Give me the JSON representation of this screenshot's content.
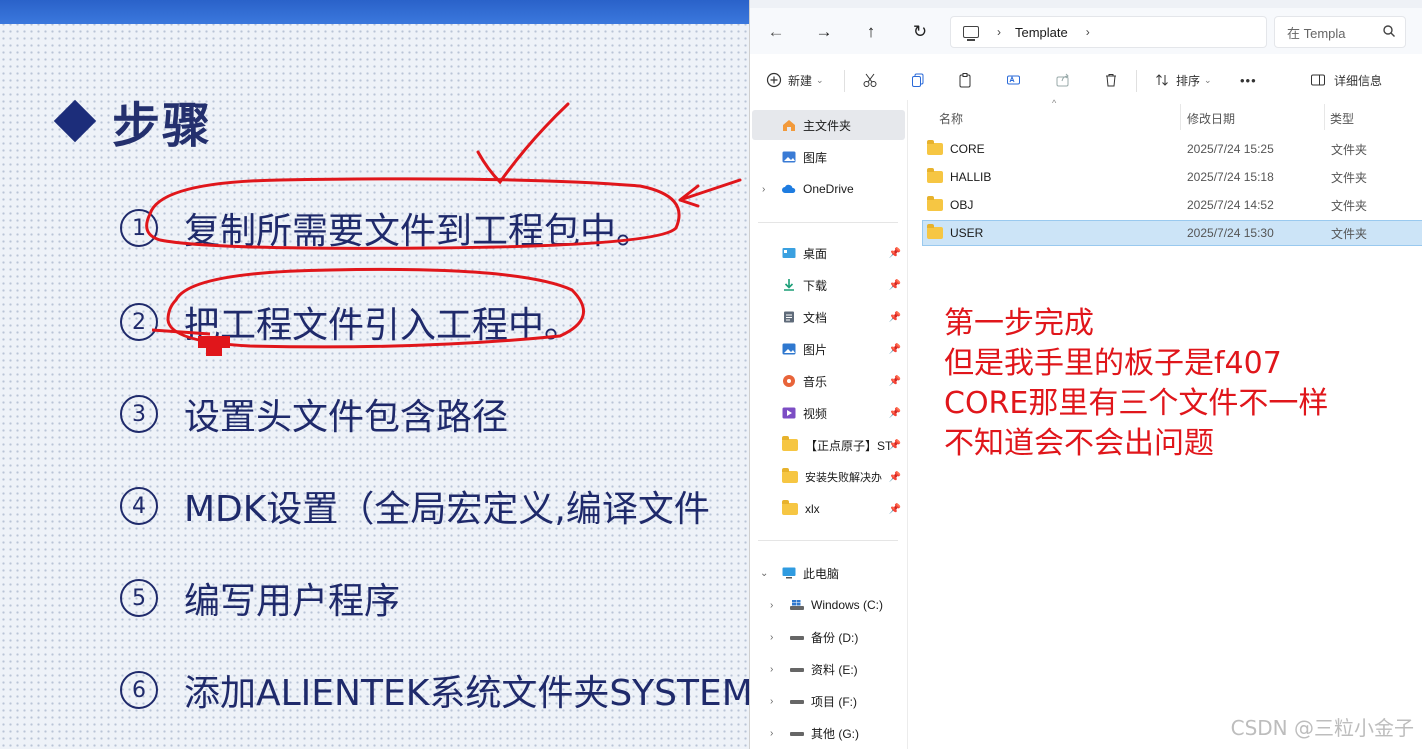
{
  "slide": {
    "heading": "步骤",
    "steps": [
      {
        "num": "1",
        "text": "复制所需要文件到工程包中。"
      },
      {
        "num": "2",
        "text": "把工程文件引入工程中。"
      },
      {
        "num": "3",
        "text": "设置头文件包含路径"
      },
      {
        "num": "4",
        "text": "MDK设置（全局宏定义,编译文件"
      },
      {
        "num": "5",
        "text": "编写用户程序"
      },
      {
        "num": "6",
        "text": "添加ALIENTEK系统文件夹SYSTEM"
      }
    ]
  },
  "explorer": {
    "breadcrumb": "Template",
    "search_placeholder": "在 Templa",
    "toolbar": {
      "new_label": "新建",
      "sort_label": "排序",
      "more_label": "•••",
      "details_label": "详细信息"
    },
    "sidebar": {
      "home": "主文件夹",
      "gallery": "图库",
      "onedrive": "OneDrive",
      "quick": [
        {
          "label": "桌面",
          "icon": "desktop-icon"
        },
        {
          "label": "下载",
          "icon": "download-icon"
        },
        {
          "label": "文档",
          "icon": "document-icon"
        },
        {
          "label": "图片",
          "icon": "pictures-icon"
        },
        {
          "label": "音乐",
          "icon": "music-icon"
        },
        {
          "label": "视频",
          "icon": "video-icon"
        },
        {
          "label": "【正点原子】ST",
          "icon": "folder-icon"
        },
        {
          "label": "安装失败解决办",
          "icon": "folder-icon"
        },
        {
          "label": "xlx",
          "icon": "folder-icon"
        }
      ],
      "this_pc": "此电脑",
      "drives": [
        "Windows (C:)",
        "备份 (D:)",
        "资料 (E:)",
        "项目 (F:)",
        "其他 (G:)"
      ]
    },
    "columns": {
      "name": "名称",
      "date": "修改日期",
      "type": "类型"
    },
    "files": [
      {
        "name": "CORE",
        "date": "2025/7/24 15:25",
        "type": "文件夹"
      },
      {
        "name": "HALLIB",
        "date": "2025/7/24 15:18",
        "type": "文件夹"
      },
      {
        "name": "OBJ",
        "date": "2025/7/24 14:52",
        "type": "文件夹"
      },
      {
        "name": "USER",
        "date": "2025/7/24 15:30",
        "type": "文件夹",
        "selected": true
      }
    ]
  },
  "annotation": {
    "lines": [
      "第一步完成",
      "但是我手里的板子是f407",
      "CORE那里有三个文件不一样",
      "不知道会不会出问题"
    ],
    "color": "#e0161b"
  },
  "watermark": "CSDN @三粒小金子",
  "colors": {
    "accent": "#1f2a6b",
    "selection": "#cce4f7",
    "folder": "#f6c643",
    "ink": "#e0161b"
  }
}
